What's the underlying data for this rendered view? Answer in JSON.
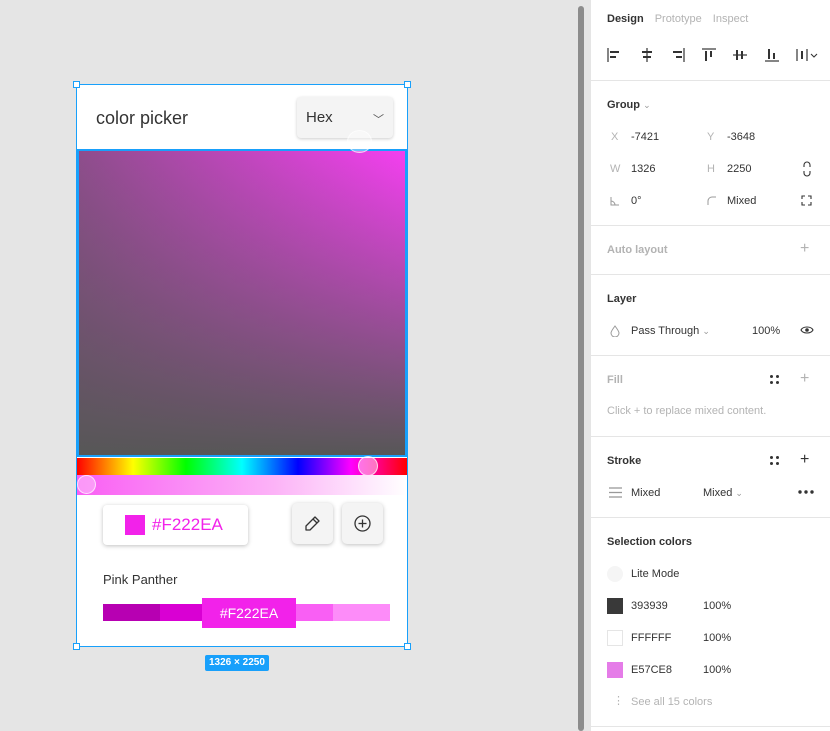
{
  "canvas": {
    "frame": {
      "title": "color picker",
      "format_select": {
        "value": "Hex",
        "chevron": "﹀"
      },
      "selected_color": "#F222EA",
      "hex_input": {
        "value": "#F222EA"
      },
      "eyedropper_icon": "eyedropper-icon",
      "add_icon": "plus-circle-icon",
      "palette": {
        "name": "Pink Panther",
        "chip_value": "#F222EA",
        "segments": [
          "#b700b2",
          "#d900d3",
          "#f222ea",
          "#f95ff4",
          "#fd8cf9"
        ]
      }
    },
    "size_badge": "1326 × 2250"
  },
  "panel": {
    "tabs": [
      {
        "label": "Design",
        "active": true
      },
      {
        "label": "Prototype",
        "active": false
      },
      {
        "label": "Inspect",
        "active": false
      }
    ],
    "align_icons": [
      "align-left-icon",
      "align-h-center-icon",
      "align-right-icon",
      "align-top-icon",
      "align-v-center-icon",
      "align-bottom-icon",
      "distribute-icon"
    ],
    "group": {
      "title": "Group",
      "x_label": "X",
      "x": "-7421",
      "y_label": "Y",
      "y": "-3648",
      "w_label": "W",
      "w": "1326",
      "h_label": "H",
      "h": "2250",
      "rotation": "0°",
      "radius": "Mixed"
    },
    "auto_layout": {
      "title": "Auto layout"
    },
    "layer": {
      "title": "Layer",
      "blend": "Pass Through",
      "opacity": "100%"
    },
    "fill": {
      "title": "Fill",
      "hint": "Click + to replace mixed content."
    },
    "stroke": {
      "title": "Stroke",
      "color": "Mixed",
      "weight": "Mixed"
    },
    "selection_colors": {
      "title": "Selection colors",
      "items": [
        {
          "name": "Lite Mode",
          "swatch": "#f5f5f5",
          "pct": ""
        },
        {
          "name": "393939",
          "swatch": "#393939",
          "pct": "100%"
        },
        {
          "name": "FFFFFF",
          "swatch": "#ffffff",
          "pct": "100%"
        },
        {
          "name": "E57CE8",
          "swatch": "#e57ce8",
          "pct": "100%"
        }
      ],
      "see_all": "See all 15 colors"
    }
  }
}
